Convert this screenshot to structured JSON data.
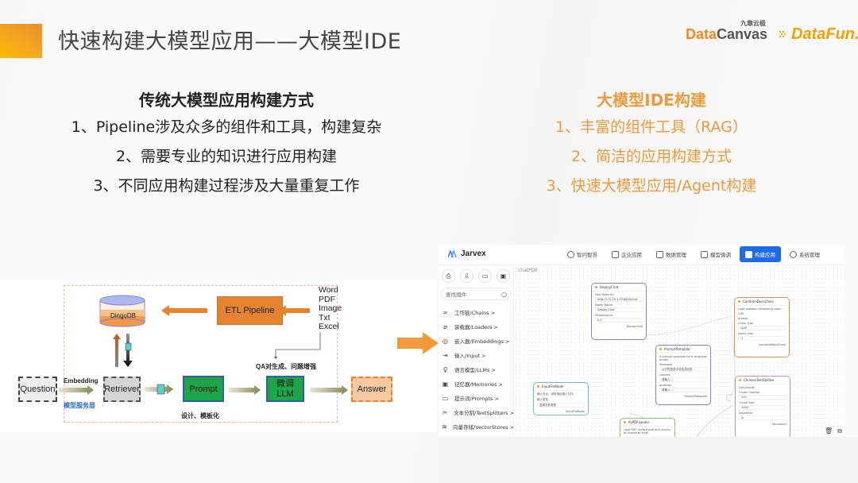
{
  "header": {
    "title": "快速构建大模型应用——大模型IDE",
    "logos": {
      "datacanvas_small": "九章云极",
      "datacanvas_part1": "Data",
      "datacanvas_part2": "Canvas",
      "datafun": "DataFun."
    }
  },
  "left_column": {
    "heading": "传统大模型应用构建方式",
    "points": [
      "1、Pipeline涉及众多的组件和工具，构建复杂",
      "2、需要专业的知识进行应用构建",
      "3、不同应用构建过程涉及大量重复工作"
    ]
  },
  "right_column": {
    "heading": "大模型IDE构建",
    "points": [
      "1、丰富的组件工具（RAG）",
      "2、简洁的应用构建方式",
      "3、快速大模型应用/Agent构建"
    ]
  },
  "diagram": {
    "db_label": "DingoDB",
    "etl_label": "ETL Pipeline",
    "formats": [
      "Word",
      "PDF",
      "Image",
      "Txt",
      "Excel"
    ],
    "question": "Question",
    "embedding": "Embedding",
    "service_layer": "模型服务层",
    "retriever": "Retriever",
    "prompt": "Prompt",
    "llm_line1": "微调",
    "llm_line2": "LLM",
    "answer": "Answer",
    "qa_label": "QA对生成、问题增强",
    "design_label": "设计、模板化"
  },
  "colors": {
    "accent_orange": "#EE9A3A",
    "primary_blue": "#1F6BF0",
    "etl_orange": "#E5832F",
    "green": "#1EA548"
  },
  "app": {
    "name": "Jarvex",
    "nav": [
      {
        "label": "智问智答",
        "icon": "chat-icon",
        "active": false
      },
      {
        "label": "企业应用",
        "icon": "home-icon",
        "active": false
      },
      {
        "label": "数据管理",
        "icon": "data-icon",
        "active": false
      },
      {
        "label": "模型微调",
        "icon": "cube-icon",
        "active": false
      },
      {
        "label": "构建应用",
        "icon": "build-icon",
        "active": true
      },
      {
        "label": "系统管理",
        "icon": "settings-icon",
        "active": false
      }
    ],
    "search_placeholder": "查找组件",
    "categories": [
      {
        "label": "工作链/Chains >",
        "icon": "link-icon"
      },
      {
        "label": "装载器/Loaders >",
        "icon": "paperclip-icon"
      },
      {
        "label": "嵌入器/Embeddings >",
        "icon": "fingerprint-icon"
      },
      {
        "label": "输入/Input >",
        "icon": "input-icon"
      },
      {
        "label": "语言模型/LLMs >",
        "icon": "lightbulb-icon"
      },
      {
        "label": "记忆器/Memories >",
        "icon": "chip-icon"
      },
      {
        "label": "提示词/Prompts >",
        "icon": "terminal-icon"
      },
      {
        "label": "文本分割/TextSplitters >",
        "icon": "scissors-icon"
      },
      {
        "label": "向量存储/VectorStores >",
        "icon": "layers-icon"
      }
    ],
    "canvas_title": "chatPDF",
    "nodes": {
      "deploy_chat": {
        "title": "DeployChat",
        "f1": "Host Base Url",
        "v1": "http://172.20.1.32:8810/chat",
        "f2": "Model Name",
        "v2": "Deploy Chat",
        "f3": "Temperature",
        "v3": "0.0",
        "out": "DeployChat"
      },
      "combine_docs": {
        "title": "CombineDocsChain",
        "desc": "Load question answering chain.",
        "f1": "LLM",
        "f2": "prompt",
        "f3": "Chain Type",
        "v3": "stuff",
        "f4": "token_max",
        "v4": "-1",
        "out": "CombineDocsChain"
      },
      "prompt_template": {
        "title": "PromptTemplate",
        "desc": "A prompt template for a language model.",
        "f1": "Template",
        "v1": "从已知信息中总结并回答...",
        "f2": "context",
        "v2": "请输入...",
        "f3": "question",
        "v3": "请输入...",
        "out": "PromptTemplate"
      },
      "input_file": {
        "title": "InputFileNode",
        "desc": "输入节点，用来指定输入文件",
        "f1": "输入类型",
        "v1": "选择文件类型",
        "out": "InputFileNode"
      },
      "pypdf_loader": {
        "title": "PyPDFLoader",
        "desc": "Load PDF using pypdf and chunks at character level."
      },
      "text_splitter": {
        "title": "ChineseTextSplitter",
        "f1": "Documents",
        "f2": "Chunk Overlap",
        "v2": "200",
        "f3": "Chunk Size",
        "v3": "1000",
        "f4": "Separator",
        "v4": "\\n",
        "out": "Document"
      }
    }
  }
}
